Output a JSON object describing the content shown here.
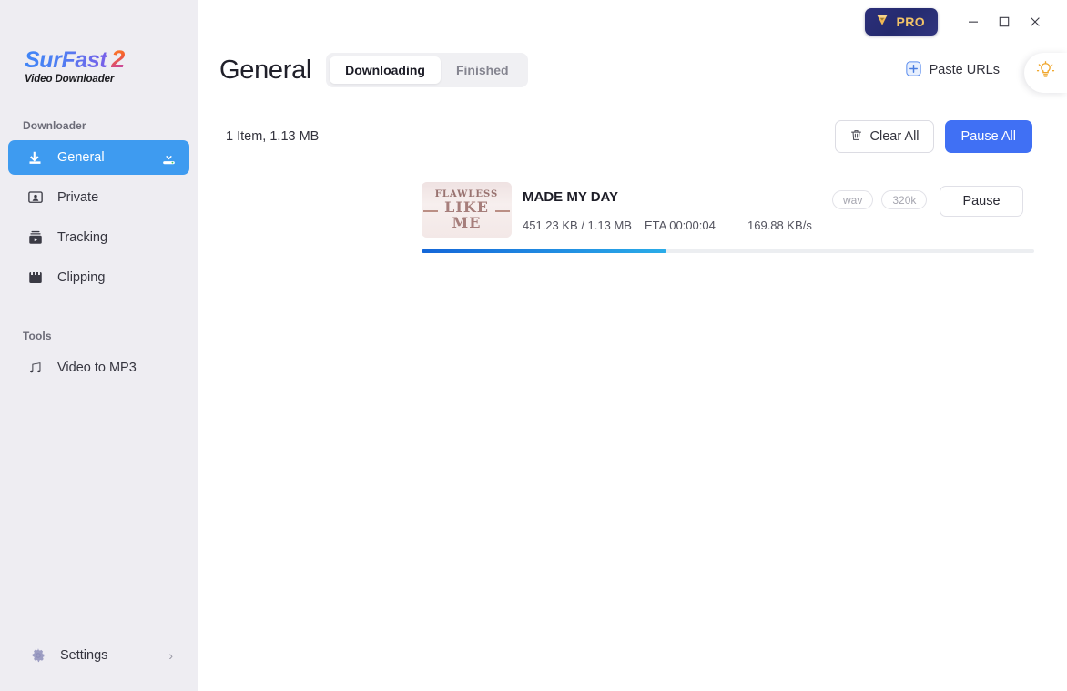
{
  "brand": {
    "name_main": "SurFast",
    "name_version": "2",
    "subtitle": "Video Downloader"
  },
  "sidebar": {
    "downloader_label": "Downloader",
    "tools_label": "Tools",
    "items": [
      {
        "label": "General",
        "icon": "download-arrow-icon",
        "active": true
      },
      {
        "label": "Private",
        "icon": "private-person-icon",
        "active": false
      },
      {
        "label": "Tracking",
        "icon": "tracking-play-icon",
        "active": false
      },
      {
        "label": "Clipping",
        "icon": "clipping-film-icon",
        "active": false
      }
    ],
    "tools": [
      {
        "label": "Video to MP3",
        "icon": "music-note-icon"
      }
    ],
    "settings": {
      "label": "Settings",
      "icon": "gear-icon",
      "chevron": "›"
    }
  },
  "titlebar": {
    "pro_label": "PRO",
    "pro_icon": "gem-diamond-icon",
    "minimize": "minimize-icon",
    "maximize": "maximize-icon",
    "close": "close-icon"
  },
  "header": {
    "title": "General",
    "tabs": [
      {
        "label": "Downloading",
        "active": true
      },
      {
        "label": "Finished",
        "active": false
      }
    ],
    "paste_urls_label": "Paste URLs",
    "paste_urls_icon": "plus-square-icon",
    "bulb_icon": "lightbulb-icon"
  },
  "toolbar": {
    "item_count": "1 Item, 1.13 MB",
    "clear_all_label": "Clear All",
    "clear_all_icon": "trash-icon",
    "pause_all_label": "Pause All"
  },
  "download": {
    "title": "MADE MY DAY",
    "thumbnail_text": [
      "FLAWLESS",
      "LIKE",
      "ME"
    ],
    "size": "451.23 KB / 1.13 MB",
    "eta": "ETA 00:00:04",
    "speed": "169.88 KB/s",
    "badges": [
      "wav",
      "320k"
    ],
    "action_label": "Pause",
    "progress_percent": 40
  },
  "colors": {
    "accent_blue": "#4070f4",
    "sidebar_active": "#3e9bf0",
    "sidebar_bg": "#eeedf2",
    "pro_gold": "#f2c368",
    "progress_start": "#1466d8",
    "progress_end": "#2aace8"
  }
}
